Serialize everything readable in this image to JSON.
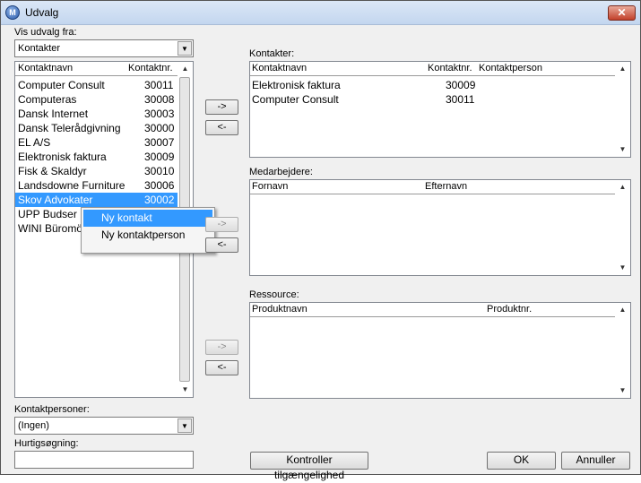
{
  "window": {
    "title": "Udvalg",
    "close_glyph": "✕"
  },
  "left": {
    "vis_label": "Vis udvalg fra:",
    "vis_value": "Kontakter",
    "list_headers": [
      "Kontaktnavn",
      "Kontaktnr."
    ],
    "rows": [
      {
        "name": "Computer Consult",
        "nr": "30011"
      },
      {
        "name": "Computeras",
        "nr": "30008"
      },
      {
        "name": "Dansk Internet",
        "nr": "30003"
      },
      {
        "name": "Dansk Telerådgivning",
        "nr": "30000"
      },
      {
        "name": "EL A/S",
        "nr": "30007"
      },
      {
        "name": "Elektronisk faktura",
        "nr": "30009"
      },
      {
        "name": "Fisk & Skaldyr",
        "nr": "30010"
      },
      {
        "name": "Landsdowne Furniture",
        "nr": "30006"
      },
      {
        "name": "Skov Advokater",
        "nr": "30002"
      },
      {
        "name": "UPP Budser",
        "nr": ""
      },
      {
        "name": "WINI Büromö",
        "nr": ""
      }
    ],
    "selected_index": 8,
    "kontaktpersoner_label": "Kontaktpersoner:",
    "kontaktpersoner_value": "(Ingen)",
    "hurtig_label": "Hurtigsøgning:",
    "hurtig_value": ""
  },
  "context_menu": {
    "items": [
      "Ny kontakt",
      "Ny kontaktperson"
    ]
  },
  "transfer": {
    "add": "->",
    "remove": "<-"
  },
  "right": {
    "kontakter": {
      "label": "Kontakter:",
      "headers": [
        "Kontaktnavn",
        "Kontaktnr.",
        "Kontaktperson"
      ],
      "rows": [
        {
          "name": "Elektronisk faktura",
          "nr": "30009",
          "person": ""
        },
        {
          "name": "Computer Consult",
          "nr": "30011",
          "person": ""
        }
      ]
    },
    "medarbejdere": {
      "label": "Medarbejdere:",
      "headers": [
        "Fornavn",
        "Efternavn"
      ]
    },
    "ressource": {
      "label": "Ressource:",
      "headers": [
        "Produktnavn",
        "Produktnr."
      ]
    }
  },
  "footer": {
    "check": "Kontroller tilgængelighed",
    "ok": "OK",
    "cancel": "Annuller"
  }
}
